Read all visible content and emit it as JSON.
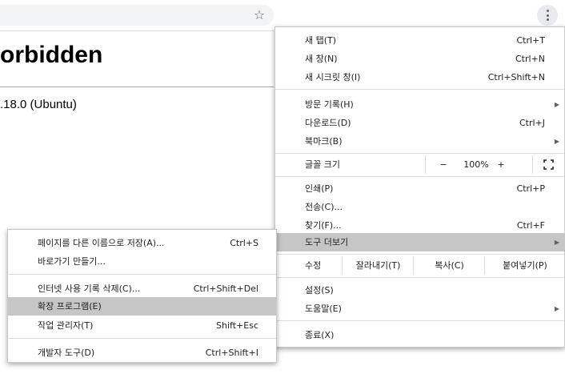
{
  "page": {
    "title": "orbidden",
    "server": ".18.0 (Ubuntu)"
  },
  "toolbar": {
    "star_glyph": "☆"
  },
  "main_menu": {
    "new_tab": {
      "label": "새 탭(T)",
      "shortcut": "Ctrl+T"
    },
    "new_window": {
      "label": "새 창(N)",
      "shortcut": "Ctrl+N"
    },
    "new_incognito": {
      "label": "새 시크릿 창(I)",
      "shortcut": "Ctrl+Shift+N"
    },
    "history": {
      "label": "방문 기록(H)"
    },
    "downloads": {
      "label": "다운로드(D)",
      "shortcut": "Ctrl+J"
    },
    "bookmarks": {
      "label": "북마크(B)"
    },
    "zoom": {
      "label": "글꼴 크기",
      "minus": "−",
      "value": "100%",
      "plus": "+"
    },
    "print": {
      "label": "인쇄(P)",
      "shortcut": "Ctrl+P"
    },
    "cast": {
      "label": "전송(C)..."
    },
    "find": {
      "label": "찾기(F)...",
      "shortcut": "Ctrl+F"
    },
    "more_tools": {
      "label": "도구 더보기"
    },
    "edit": {
      "label": "수정",
      "cut": "잘라내기(T)",
      "copy": "복사(C)",
      "paste": "붙여넣기(P)"
    },
    "settings": {
      "label": "설정(S)"
    },
    "help": {
      "label": "도움말(E)"
    },
    "exit": {
      "label": "종료(X)"
    }
  },
  "sub_menu": {
    "save_page": {
      "label": "페이지를 다른 이름으로 저장(A)...",
      "shortcut": "Ctrl+S"
    },
    "create_shortcut": {
      "label": "바로가기 만들기..."
    },
    "clear_browsing": {
      "label": "인터넷 사용 기록 삭제(C)...",
      "shortcut": "Ctrl+Shift+Del"
    },
    "extensions": {
      "label": "확장 프로그램(E)"
    },
    "task_manager": {
      "label": "작업 관리자(T)",
      "shortcut": "Shift+Esc"
    },
    "developer_tools": {
      "label": "개발자 도구(D)",
      "shortcut": "Ctrl+Shift+I"
    }
  },
  "colors": {
    "highlight": "#c6c6c6",
    "omnibox": "#f1f3f4",
    "separator": "#dcdcdc"
  }
}
